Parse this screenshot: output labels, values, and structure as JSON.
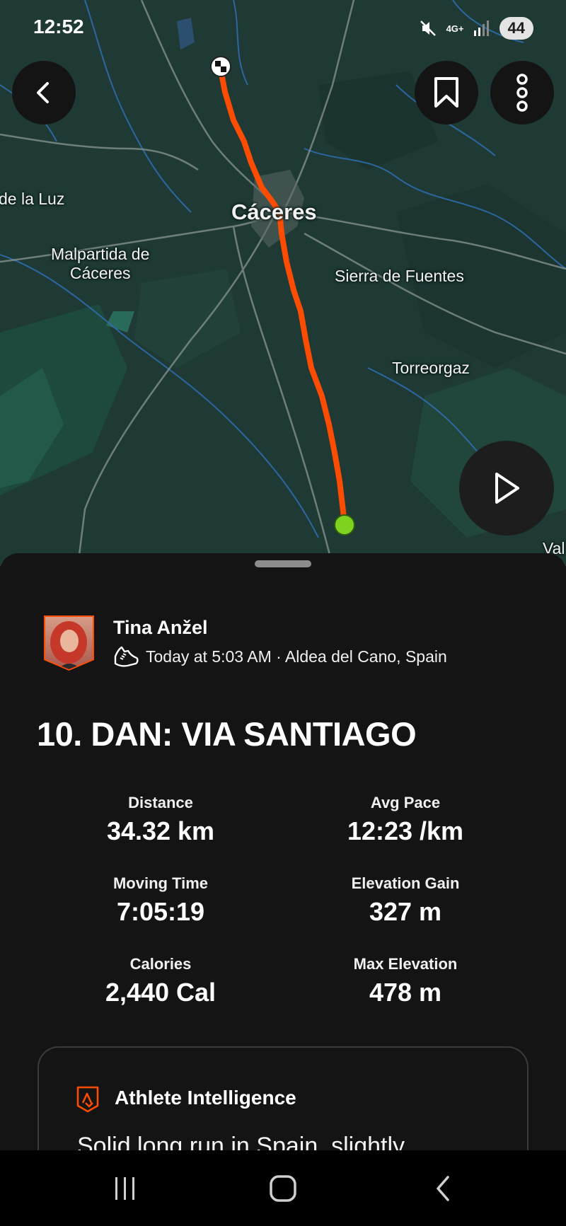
{
  "status_bar": {
    "time": "12:52",
    "network": "4G+",
    "battery": "44"
  },
  "map": {
    "labels": {
      "de_la_luz": "de la Luz",
      "caceres": "Cáceres",
      "malpartida": "Malpartida de\nCáceres",
      "sierra_de_fuentes": "Sierra de Fuentes",
      "torreorgaz": "Torreorgaz",
      "val": "Val"
    },
    "route_color": "#fc4c02",
    "start_color": "#7ed321"
  },
  "activity": {
    "athlete_name": "Tina Anžel",
    "meta": "Today at 5:03 AM · Aldea del Cano, Spain",
    "title": "10. DAN: VIA SANTIAGO",
    "stats": {
      "distance": {
        "label": "Distance",
        "value": "34.32 km"
      },
      "avg_pace": {
        "label": "Avg Pace",
        "value": "12:23 /km"
      },
      "moving_time": {
        "label": "Moving Time",
        "value": "7:05:19"
      },
      "elevation_gain": {
        "label": "Elevation Gain",
        "value": "327 m"
      },
      "calories": {
        "label": "Calories",
        "value": "2,440 Cal"
      },
      "max_elevation": {
        "label": "Max Elevation",
        "value": "478 m"
      }
    },
    "athlete_intelligence": {
      "title": "Athlete Intelligence",
      "text": "Solid long run in Spain, slightly"
    }
  },
  "icons": {
    "back": "chevron-left-icon",
    "bookmark": "bookmark-icon",
    "more": "more-vertical-icon",
    "play": "play-icon",
    "shoe": "shoe-icon",
    "ai": "strava-logo-icon"
  },
  "colors": {
    "accent": "#fc4c02",
    "background": "#141414"
  }
}
